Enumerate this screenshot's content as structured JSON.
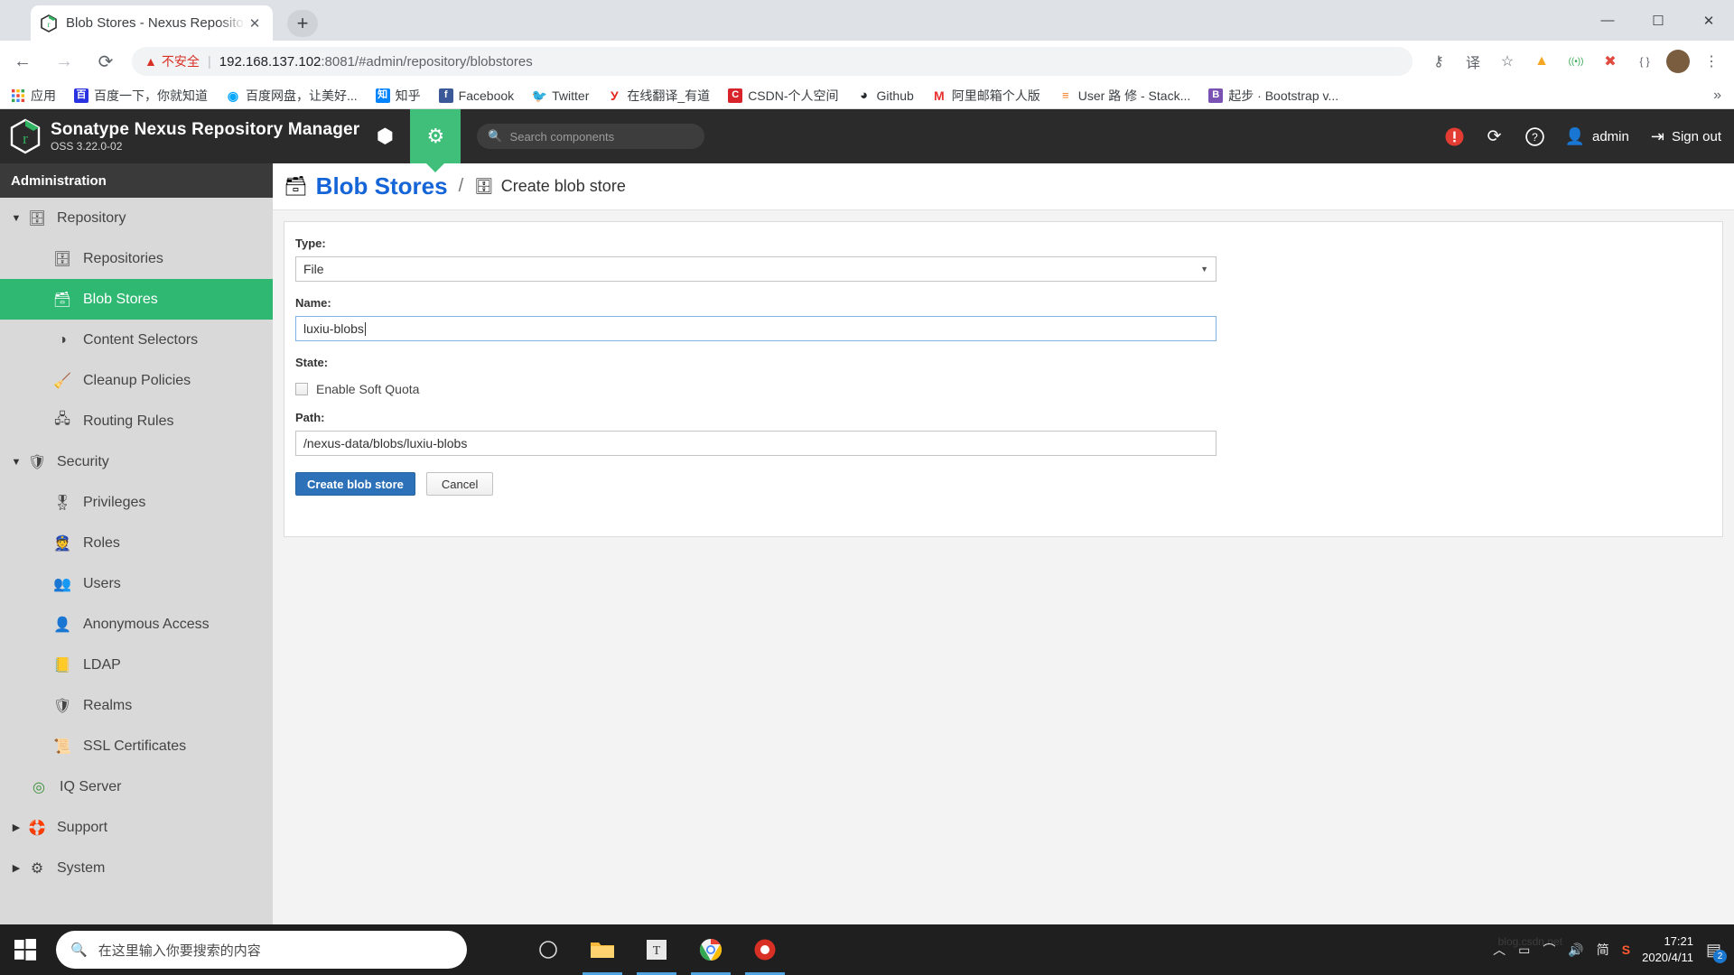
{
  "browser": {
    "tab": {
      "title": "Blob Stores - Nexus Repository",
      "close_label": "✕",
      "favicon": "nexus-logo-icon"
    },
    "newtab_label": "+",
    "window_controls": {
      "minimize": "—",
      "maximize": "☐",
      "close": "✕"
    },
    "nav": {
      "back": "←",
      "forward": "→",
      "reload": "⟳"
    },
    "omnibox": {
      "warning_icon": "▲",
      "warning_text": "不安全",
      "separator": "|",
      "url_host": "192.168.137.102",
      "url_rest": ":8081/#admin/repository/blobstores"
    },
    "toolbar_icons": [
      {
        "name": "password-key-icon",
        "glyph": "⚷"
      },
      {
        "name": "translate-icon",
        "glyph": "译"
      },
      {
        "name": "bookmark-star-icon",
        "glyph": "☆"
      },
      {
        "name": "extension-color-icon",
        "glyph": "▲"
      },
      {
        "name": "extension-wifi-icon",
        "glyph": "((•))"
      },
      {
        "name": "extension-block-icon",
        "glyph": "✖"
      },
      {
        "name": "extension-code-icon",
        "glyph": "{ }"
      }
    ],
    "avatar_label": "",
    "menu_glyph": "⋮",
    "bookmarks": [
      {
        "label": "应用",
        "icon": "apps-grid-icon",
        "icon_text": "",
        "color": "#ffffff"
      },
      {
        "label": "百度一下，你就知道",
        "icon": "baidu-icon",
        "icon_text": "百",
        "color": "#2932e1"
      },
      {
        "label": "百度网盘，让美好...",
        "icon": "baidu-pan-icon",
        "icon_text": "◉",
        "color": "#06a7ff"
      },
      {
        "label": "知乎",
        "icon": "zhihu-icon",
        "icon_text": "知",
        "color": "#0084ff"
      },
      {
        "label": "Facebook",
        "icon": "facebook-icon",
        "icon_text": "f",
        "color": "#3b5998"
      },
      {
        "label": "Twitter",
        "icon": "twitter-icon",
        "icon_text": "t",
        "color": "#1da1f2"
      },
      {
        "label": "在线翻译_有道",
        "icon": "youdao-icon",
        "icon_text": "У",
        "color": "#e1251b"
      },
      {
        "label": "CSDN-个人空间",
        "icon": "csdn-icon",
        "icon_text": "C",
        "color": "#d8232a"
      },
      {
        "label": "Github",
        "icon": "github-icon",
        "icon_text": "G",
        "color": "#24292e"
      },
      {
        "label": "阿里邮箱个人版",
        "icon": "alimail-icon",
        "icon_text": "M",
        "color": "#e8302f"
      },
      {
        "label": "User 路 修 - Stack...",
        "icon": "stackoverflow-icon",
        "icon_text": "S",
        "color": "#f48024"
      },
      {
        "label": "起步 · Bootstrap v...",
        "icon": "bootstrap-icon",
        "icon_text": "B",
        "color": "#7952b3"
      }
    ],
    "bookmarks_overflow": "»"
  },
  "nexus": {
    "brand": {
      "title": "Sonatype Nexus Repository Manager",
      "version": "OSS 3.22.0-02"
    },
    "header_buttons": [
      {
        "name": "browse-cube-button",
        "glyph": "⬢",
        "active": false
      },
      {
        "name": "admin-gear-button",
        "glyph": "⚙",
        "active": true
      }
    ],
    "search": {
      "placeholder": "Search components",
      "icon": "search-icon"
    },
    "header_right": {
      "alert_icon": "!",
      "refresh_icon": "⟳",
      "help_icon": "?",
      "user_icon": "person-icon",
      "user_label": "admin",
      "signout_icon": "exit-icon",
      "signout_label": "Sign out"
    },
    "sidebar": {
      "header": "Administration",
      "items": [
        {
          "label": "Repository",
          "level": "group",
          "icon": "database-icon",
          "glyph": "🗄",
          "caret": "▼",
          "selected": false
        },
        {
          "label": "Repositories",
          "level": "child",
          "icon": "database-icon",
          "glyph": "🗄",
          "selected": false
        },
        {
          "label": "Blob Stores",
          "level": "child",
          "icon": "blobstore-icon",
          "glyph": "🗃",
          "selected": true
        },
        {
          "label": "Content Selectors",
          "level": "child",
          "icon": "content-selector-icon",
          "glyph": "◑",
          "selected": false
        },
        {
          "label": "Cleanup Policies",
          "level": "child",
          "icon": "broom-icon",
          "glyph": "🧹",
          "selected": false
        },
        {
          "label": "Routing Rules",
          "level": "child",
          "icon": "router-icon",
          "glyph": "🖧",
          "selected": false
        },
        {
          "label": "Security",
          "level": "group",
          "icon": "security-icon",
          "glyph": "🛡",
          "caret": "▼",
          "selected": false
        },
        {
          "label": "Privileges",
          "level": "child",
          "icon": "medal-icon",
          "glyph": "🎖",
          "selected": false
        },
        {
          "label": "Roles",
          "level": "child",
          "icon": "officer-icon",
          "glyph": "👮",
          "selected": false
        },
        {
          "label": "Users",
          "level": "child",
          "icon": "users-icon",
          "glyph": "👥",
          "selected": false
        },
        {
          "label": "Anonymous Access",
          "level": "child",
          "icon": "anonymous-icon",
          "glyph": "👤",
          "selected": false
        },
        {
          "label": "LDAP",
          "level": "child",
          "icon": "ldap-icon",
          "glyph": "📒",
          "selected": false
        },
        {
          "label": "Realms",
          "level": "child",
          "icon": "realms-icon",
          "glyph": "🛡",
          "selected": false
        },
        {
          "label": "SSL Certificates",
          "level": "child",
          "icon": "certificate-icon",
          "glyph": "📜",
          "selected": false
        },
        {
          "label": "IQ Server",
          "level": "group-child",
          "icon": "iq-server-icon",
          "glyph": "◎",
          "selected": false
        },
        {
          "label": "Support",
          "level": "group",
          "icon": "support-icon",
          "glyph": "🛟",
          "caret": "▶",
          "selected": false
        },
        {
          "label": "System",
          "level": "group",
          "icon": "system-icon",
          "glyph": "⚙",
          "caret": "▶",
          "selected": false
        }
      ]
    },
    "breadcrumb": {
      "root_icon": "blobstore-icon",
      "root_glyph": "🗃",
      "root_label": "Blob Stores",
      "separator": "/",
      "current_icon": "blobstore-small-icon",
      "current_glyph": "🗄",
      "current_label": "Create blob store"
    },
    "form": {
      "type_label": "Type:",
      "type_value": "File",
      "type_arrow": "▼",
      "name_label": "Name:",
      "name_value": "luxiu-blobs",
      "state_label": "State:",
      "soft_quota_label": "Enable Soft Quota",
      "soft_quota_checked": false,
      "path_label": "Path:",
      "path_value": "/nexus-data/blobs/luxiu-blobs",
      "submit_label": "Create blob store",
      "cancel_label": "Cancel"
    }
  },
  "taskbar": {
    "start_icon": "windows-icon",
    "search": {
      "placeholder": "在这里输入你要搜索的内容",
      "icon": "search-icon"
    },
    "apps": [
      {
        "name": "cortana-icon",
        "glyph": "◯",
        "running": false
      },
      {
        "name": "file-explorer-icon",
        "glyph": "📁",
        "running": true
      },
      {
        "name": "terminal-icon",
        "glyph": "T",
        "running": true
      },
      {
        "name": "chrome-icon",
        "glyph": "◉",
        "running": true
      },
      {
        "name": "app-red-icon",
        "glyph": "◉",
        "running": true
      }
    ],
    "tray": [
      {
        "name": "show-hidden-icons",
        "glyph": "︿"
      },
      {
        "name": "battery-icon",
        "glyph": "▭"
      },
      {
        "name": "network-icon",
        "glyph": "⌒"
      },
      {
        "name": "volume-icon",
        "glyph": "🔊"
      },
      {
        "name": "ime-icon",
        "glyph": "简"
      },
      {
        "name": "sogou-icon",
        "glyph": "S"
      }
    ],
    "clock": {
      "time": "17:21",
      "date": "2020/4/11"
    },
    "notification_glyph": "▤",
    "notification_count": "2",
    "watermark": "blog.csdn.net"
  }
}
